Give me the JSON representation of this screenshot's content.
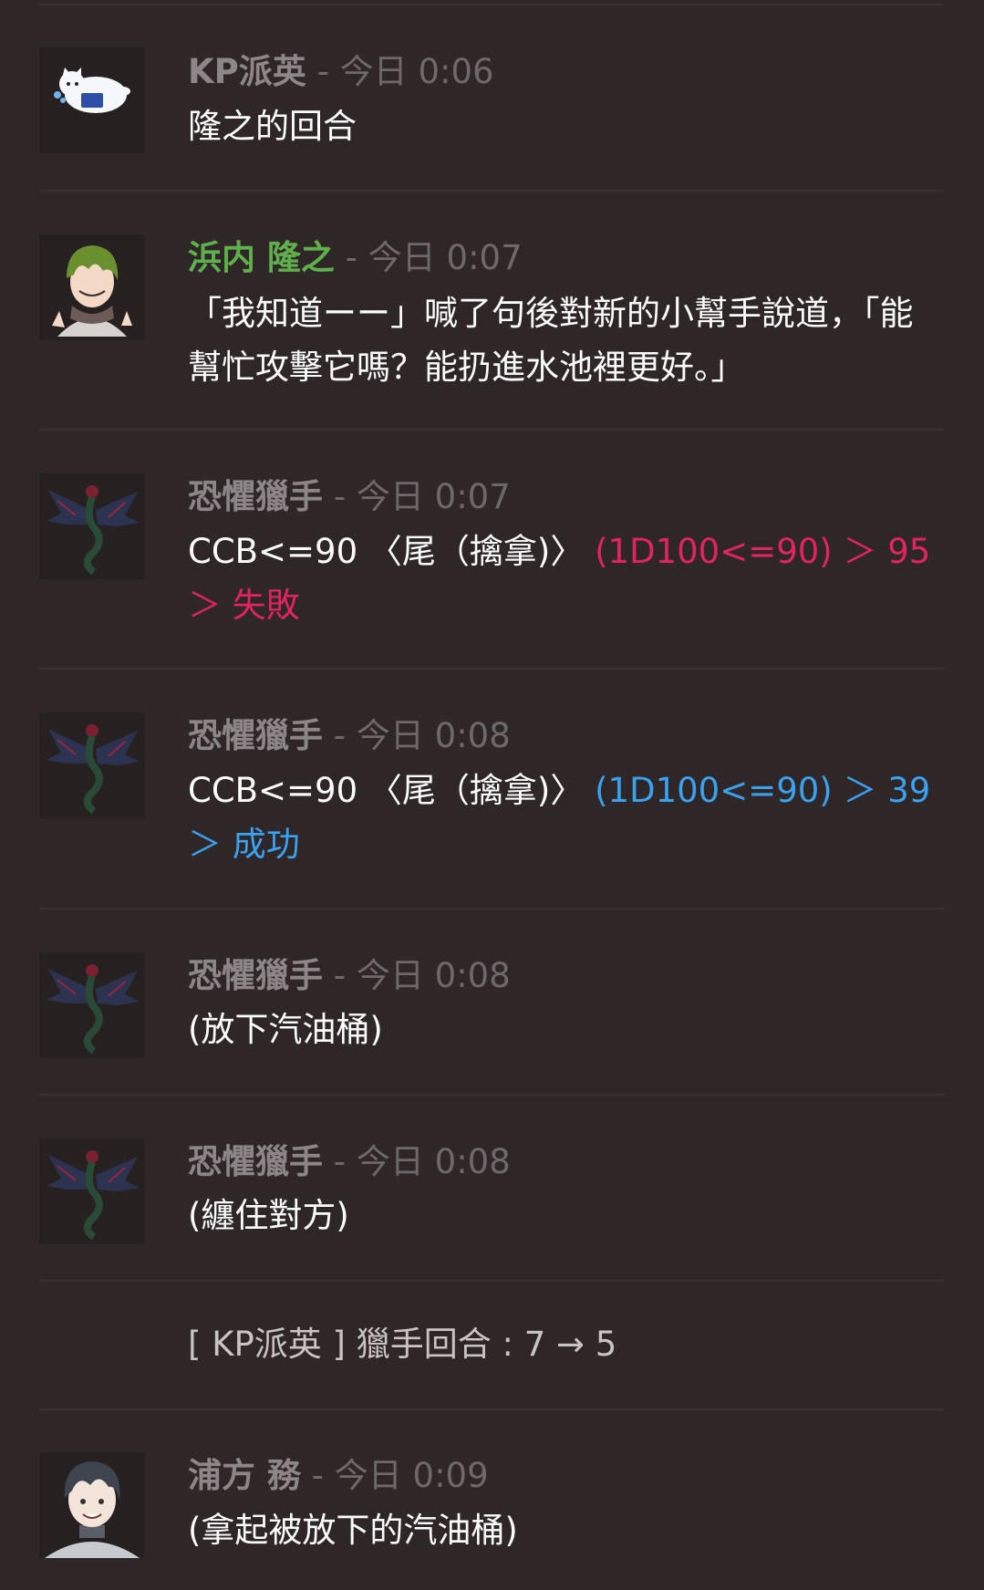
{
  "messages": [
    {
      "name": "KP派英",
      "name_color": "#8d8688",
      "separator": "-",
      "time": "今日 0:06",
      "text": "隆之的回合",
      "avatar": "cat-avatar"
    },
    {
      "name": "浜内 隆之",
      "name_color": "#5fb04d",
      "separator": "-",
      "time": "今日 0:07",
      "text": "「我知道ーー」喊了句後對新的小幫手說道，「能幫忙攻擊它嗎？能扔進水池裡更好。」",
      "avatar": "green-hair-boy-avatar"
    },
    {
      "name": "恐懼獵手",
      "name_color": "#8d8688",
      "separator": "-",
      "time": "今日 0:07",
      "text_prefix": "CCB<=90 〈尾（擒拿)〉",
      "result": "(1D100<=90) ＞ 95 ＞ 失敗",
      "result_color": "#e0245e",
      "avatar": "dragon-avatar"
    },
    {
      "name": "恐懼獵手",
      "name_color": "#8d8688",
      "separator": "-",
      "time": "今日 0:08",
      "text_prefix": "CCB<=90 〈尾（擒拿)〉",
      "result": "(1D100<=90) ＞ 39 ＞ 成功",
      "result_color": "#3aa0f0",
      "avatar": "dragon-avatar"
    },
    {
      "name": "恐懼獵手",
      "name_color": "#8d8688",
      "separator": "-",
      "time": "今日 0:08",
      "text": "(放下汽油桶)",
      "avatar": "dragon-avatar"
    },
    {
      "name": "恐懼獵手",
      "name_color": "#8d8688",
      "separator": "-",
      "time": "今日 0:08",
      "text": "(纏住對方)",
      "avatar": "dragon-avatar"
    },
    {
      "name": "浦方 務",
      "name_color": "#8d8688",
      "separator": "-",
      "time": "今日 0:09",
      "text": "(拿起被放下的汽油桶)",
      "avatar": "dark-hair-boy-avatar"
    }
  ],
  "system_message": "[ KP派英 ] 獵手回合 : 7 → 5"
}
